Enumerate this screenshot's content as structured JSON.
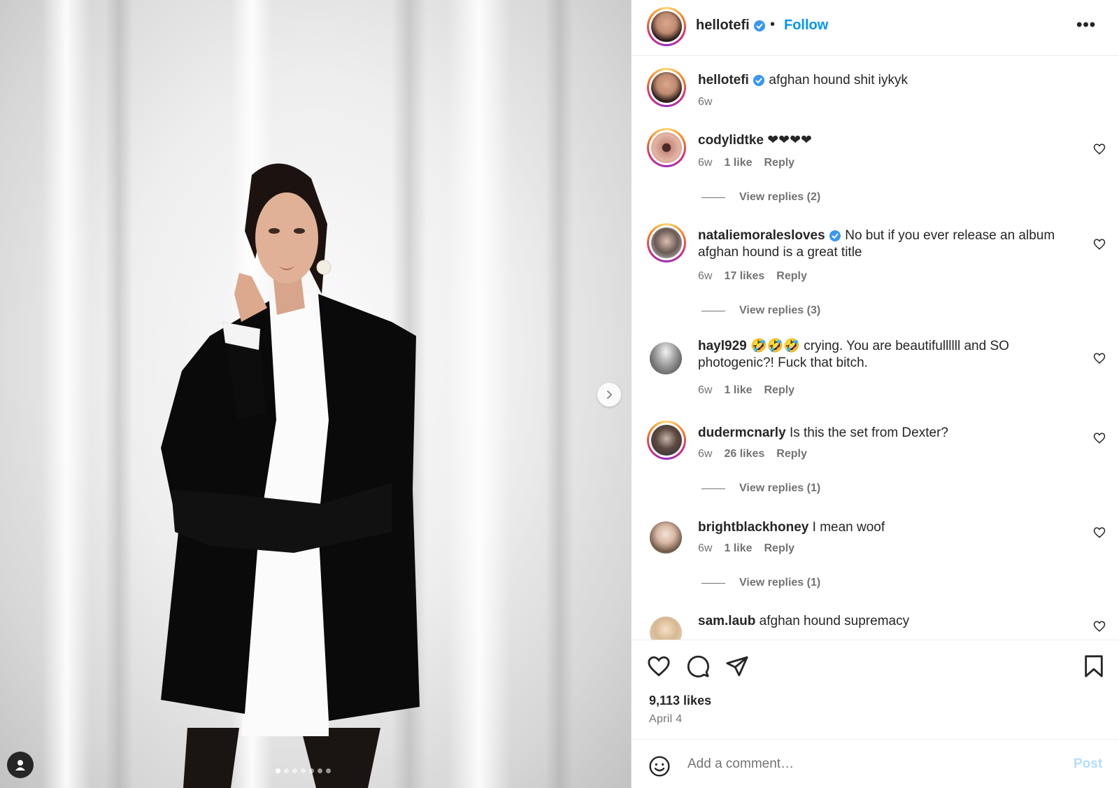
{
  "post": {
    "carousel_slides": 7,
    "active_slide": 1
  },
  "header": {
    "username": "hellotefi",
    "separator": "•",
    "follow_label": "Follow",
    "more_label": "•••"
  },
  "caption": {
    "username": "hellotefi",
    "text": "afghan hound shit iykyk",
    "time": "6w"
  },
  "comments": [
    {
      "username": "codylidtke",
      "text": "❤❤❤❤",
      "time": "6w",
      "likes": "1 like",
      "reply": "Reply",
      "view_replies": "View replies (2)"
    },
    {
      "username": "nataliemoralesloves",
      "verified": true,
      "text_line1": "No but if you ever release an album",
      "text_line2": "afghan hound is a great title",
      "time": "6w",
      "likes": "17 likes",
      "reply": "Reply",
      "view_replies": "View replies (3)"
    },
    {
      "username": "hayl929",
      "text_line1": "🤣🤣🤣 crying. You are beautifullllll and SO",
      "text_line2": "photogenic?! Fuck that bitch.",
      "time": "6w",
      "likes": "1 like",
      "reply": "Reply"
    },
    {
      "username": "dudermcnarly",
      "text": "Is this the set from Dexter?",
      "time": "6w",
      "likes": "26 likes",
      "reply": "Reply",
      "view_replies": "View replies (1)"
    },
    {
      "username": "brightblackhoney",
      "text": "I mean woof",
      "time": "6w",
      "likes": "1 like",
      "reply": "Reply",
      "view_replies": "View replies (1)"
    },
    {
      "username": "sam.laub",
      "text": "afghan hound supremacy"
    }
  ],
  "stats": {
    "likes": "9,113 likes",
    "date": "April 4"
  },
  "add_comment": {
    "placeholder": "Add a comment…",
    "post_label": "Post"
  },
  "colors": {
    "link_blue": "#0095f6",
    "verified_blue": "#3897f0",
    "post_disabled": "#b2dffc",
    "muted_text": "#737373"
  }
}
